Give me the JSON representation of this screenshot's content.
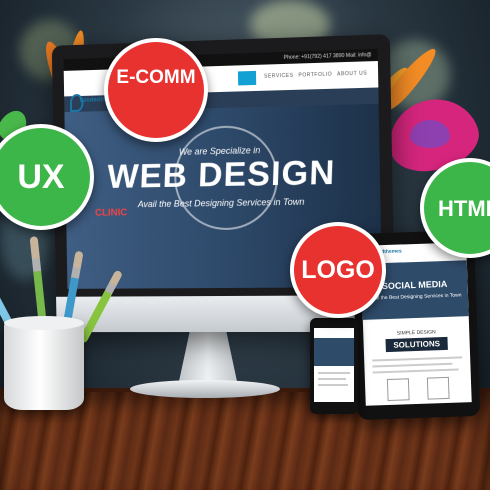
{
  "monitor_screen": {
    "contact_bar": "Phone: +91(792) 417 3890 Mail: info@",
    "nav_items": [
      "SERVICES",
      "PORTFOLIO",
      "ABOUT US"
    ],
    "brand_name": "bandedthemes",
    "clinic_label": "CLINIC",
    "hero_kicker": "We are Specialize in",
    "hero_title": "WEB DESIGN",
    "hero_subtitle": "Avail the Best Designing Services in Town"
  },
  "tablet_screen": {
    "brand_name": "bandedthemes",
    "hero_title": "SOCIAL MEDIA",
    "hero_subtitle": "Avail the Best Designing Services in Town",
    "kicker": "SIMPLE DESIGN",
    "solutions": "SOLUTIONS"
  },
  "badges": {
    "ux": "UX",
    "ecomm": "E-COMM",
    "logo": "LOGO",
    "html": "HTML"
  },
  "colors": {
    "badge_red": "#e7322f",
    "badge_green": "#3cb549",
    "accent_blue": "#12a1d2"
  }
}
